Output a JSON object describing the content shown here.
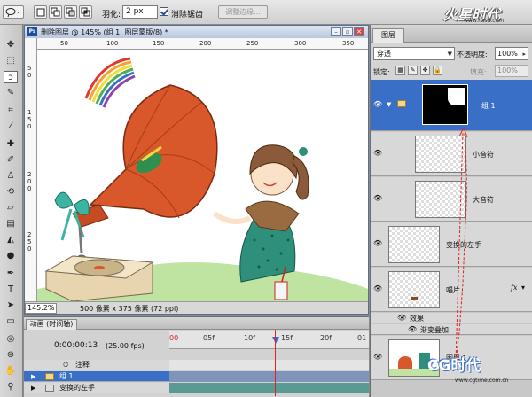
{
  "options_bar": {
    "feather_label": "羽化:",
    "feather_value": "2 px",
    "antialias_label": "消除锯齿",
    "antialias_checked": true,
    "refine_edge_label": "调整边缘..."
  },
  "watermark": {
    "logo_text": "火星时代",
    "url_text": "www.hxsd.com"
  },
  "document": {
    "title": "删除图层 @ 145% (组 1, 图层蒙版/8) *",
    "ruler_top_ticks": [
      "50",
      "100",
      "150",
      "200",
      "250",
      "300",
      "350"
    ],
    "ruler_left_ticks": [
      "5",
      "0",
      "1",
      "5",
      "0",
      "2",
      "0",
      "0",
      "2",
      "5",
      "0"
    ],
    "zoom": "145.2%",
    "info": "500 像素 x 375 像素 (72 ppi)"
  },
  "layers_panel": {
    "tab_label": "图层",
    "blend_mode": "穿透",
    "opacity_label": "不透明度:",
    "opacity_value": "100%",
    "lock_label": "锁定:",
    "fill_label": "填充:",
    "fill_value": "100%",
    "layers": [
      {
        "name": "组 1",
        "selected": true
      },
      {
        "name": "小音符",
        "selected": false
      },
      {
        "name": "大音符",
        "selected": false
      },
      {
        "name": "变换的左手",
        "selected": false
      },
      {
        "name": "唱片",
        "selected": false
      },
      {
        "name": "效果",
        "selected": false
      },
      {
        "name": "渐变叠加",
        "selected": false
      },
      {
        "name": "图层 1",
        "selected": false
      }
    ],
    "fx_label": "fx"
  },
  "timeline": {
    "tab_label": "动画 (时间轴)",
    "current_time": "0:00:00:13",
    "fps": "(25.00 fps)",
    "frame_labels": [
      "00",
      "05f",
      "10f",
      "15f",
      "20f",
      "01"
    ],
    "rows": [
      {
        "label": "注释",
        "selected": false
      },
      {
        "label": "组 1",
        "selected": true
      },
      {
        "label": "变换的左手",
        "selected": false
      }
    ]
  },
  "bottom_watermark": {
    "logo_text": "CG时代",
    "url_text": "www.cgtime.com.cn"
  },
  "colors": {
    "selection_blue": "#3a6fc7",
    "gramophone_orange": "#d9582b",
    "dress_teal": "#2e8f7a"
  }
}
